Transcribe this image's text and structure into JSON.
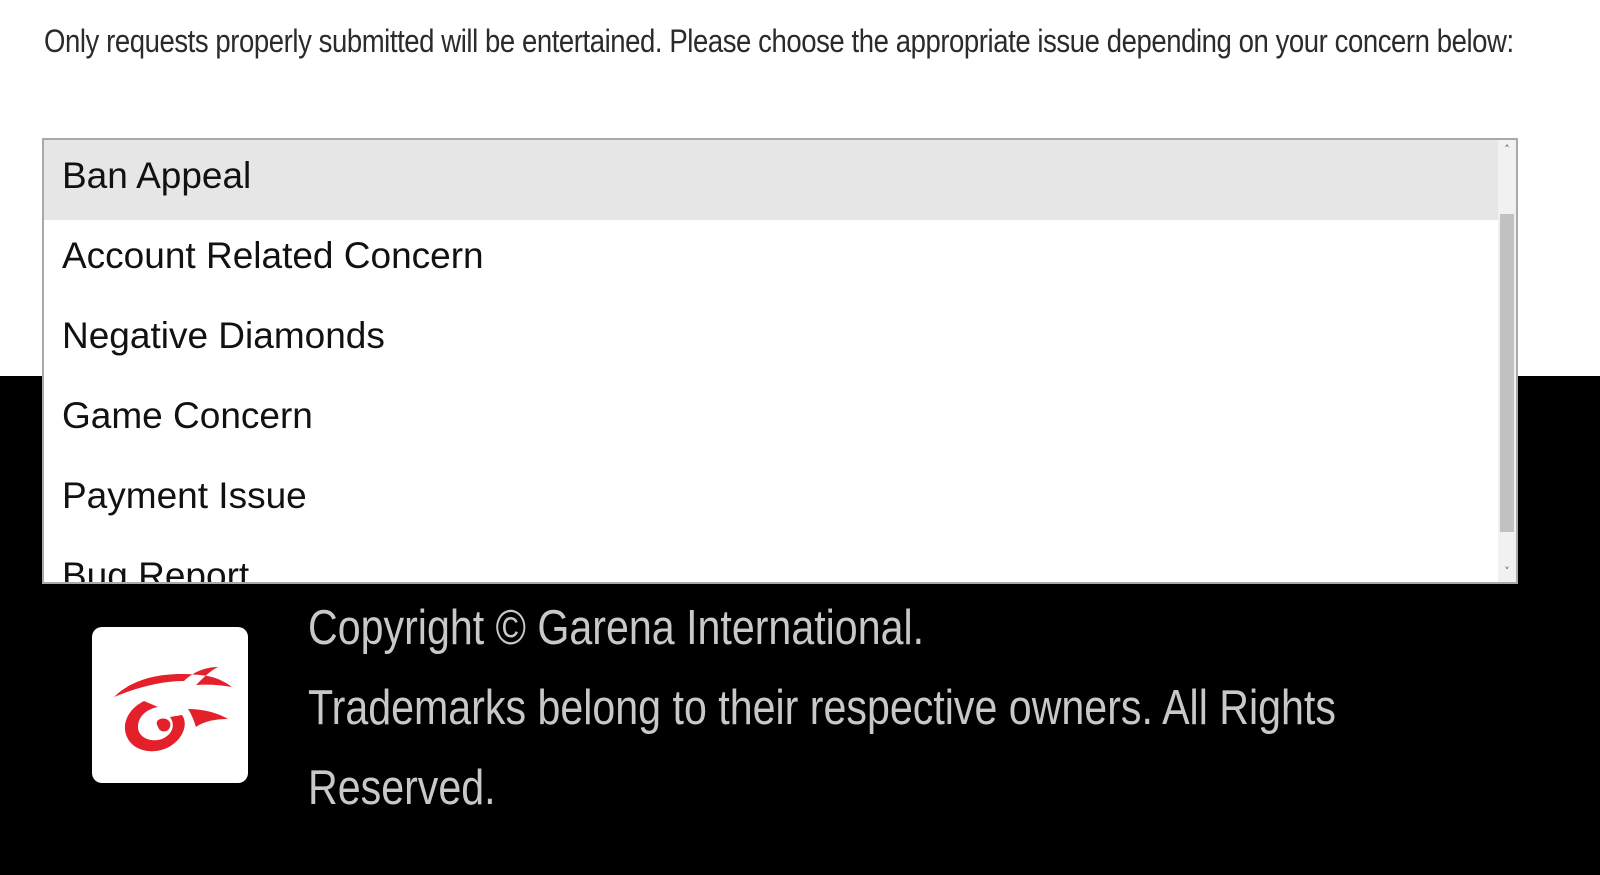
{
  "intro": {
    "text": "Only requests properly submitted will be entertained. Please choose the appropriate issue depending on your concern below:"
  },
  "issue_select": {
    "options": [
      {
        "label": "Ban Appeal",
        "selected": true
      },
      {
        "label": "Account Related Concern",
        "selected": false
      },
      {
        "label": "Negative Diamonds",
        "selected": false
      },
      {
        "label": "Game Concern",
        "selected": false
      },
      {
        "label": "Payment Issue",
        "selected": false
      },
      {
        "label": "Bug Report",
        "selected": false
      }
    ],
    "scroll_up_glyph": "˄",
    "scroll_down_glyph": "˅"
  },
  "footer": {
    "logo_icon": "garena-logo-icon",
    "logo_color": "#e4212b",
    "copyright_line": "Copyright © Garena International.",
    "trademark_line_1": "Trademarks belong to their respective owners. All Rights",
    "trademark_line_2": "Reserved."
  }
}
